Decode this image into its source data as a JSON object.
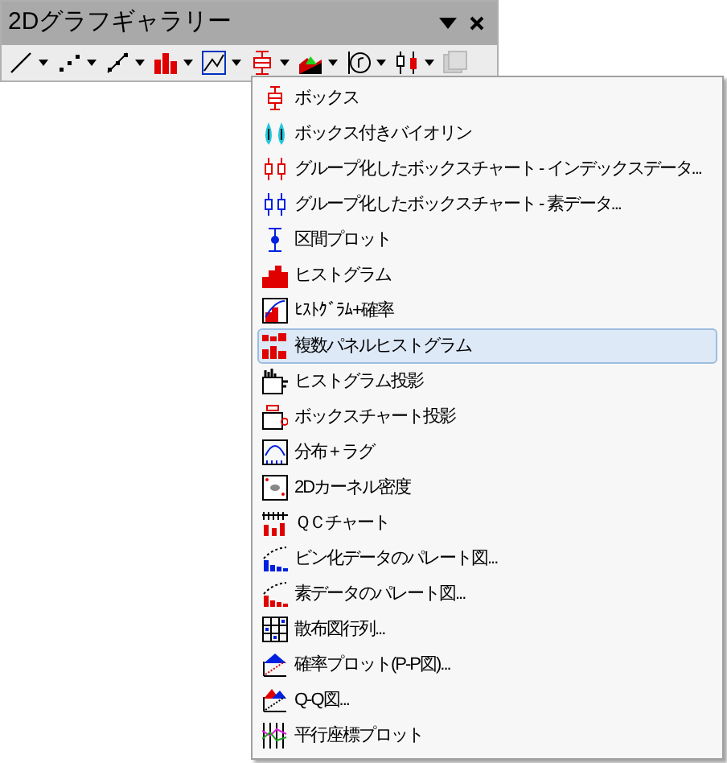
{
  "panel": {
    "title": "2Dグラフギャラリー"
  },
  "toolbar": [
    {
      "kind": "dropdown",
      "disabled": false
    },
    {
      "kind": "dropdown",
      "disabled": false
    },
    {
      "kind": "dropdown",
      "disabled": false
    },
    {
      "kind": "dropdown",
      "disabled": false
    },
    {
      "kind": "dropdown",
      "disabled": false
    },
    {
      "kind": "dropdown",
      "disabled": false
    },
    {
      "kind": "dropdown",
      "disabled": false
    },
    {
      "kind": "dropdown",
      "disabled": false
    },
    {
      "kind": "dropdown",
      "disabled": false
    },
    {
      "kind": "plain",
      "disabled": true
    }
  ],
  "menu": {
    "items": [
      {
        "label": "ボックス",
        "selected": false
      },
      {
        "label": "ボックス付きバイオリン",
        "selected": false
      },
      {
        "label": "グループ化したボックスチャート - インデックスデータ...",
        "selected": false
      },
      {
        "label": "グループ化したボックスチャート - 素データ...",
        "selected": false
      },
      {
        "label": "区間プロット",
        "selected": false
      },
      {
        "label": "ヒストグラム",
        "selected": false
      },
      {
        "label": "ﾋｽﾄｸﾞﾗﾑ+確率",
        "selected": false
      },
      {
        "label": "複数パネルヒストグラム",
        "selected": true
      },
      {
        "label": "ヒストグラム投影",
        "selected": false
      },
      {
        "label": "ボックスチャート投影",
        "selected": false
      },
      {
        "label": "分布 + ラグ",
        "selected": false
      },
      {
        "label": "2Dカーネル密度",
        "selected": false
      },
      {
        "label": "ＱＣチャート",
        "selected": false
      },
      {
        "label": "ビン化データのパレート図...",
        "selected": false
      },
      {
        "label": "素データのパレート図...",
        "selected": false
      },
      {
        "label": "散布図行列...",
        "selected": false
      },
      {
        "label": "確率プロット(P-P図)...",
        "selected": false
      },
      {
        "label": "Q-Q図...",
        "selected": false
      },
      {
        "label": "平行座標プロット",
        "selected": false
      }
    ]
  }
}
